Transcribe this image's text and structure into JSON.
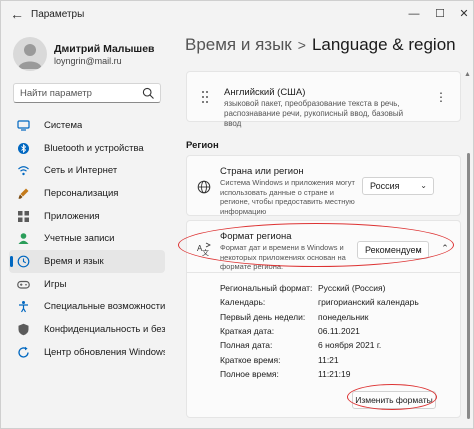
{
  "window": {
    "title": "Параметры"
  },
  "controls": {
    "minimize": "—",
    "maximize": "☐",
    "close": "✕"
  },
  "profile": {
    "name": "Дмитрий Малышев",
    "email": "loyngrin@mail.ru"
  },
  "search": {
    "placeholder": "Найти параметр"
  },
  "sidebar": {
    "items": [
      {
        "label": "Система",
        "icon": "monitor-icon",
        "color": "#0067c0"
      },
      {
        "label": "Bluetooth и устройства",
        "icon": "bluetooth-icon",
        "color": "#0067c0"
      },
      {
        "label": "Сеть и Интернет",
        "icon": "wifi-icon",
        "color": "#0067c0"
      },
      {
        "label": "Персонализация",
        "icon": "brush-icon",
        "color": "#c47a1a"
      },
      {
        "label": "Приложения",
        "icon": "apps-icon",
        "color": "#5b5b5b"
      },
      {
        "label": "Учетные записи",
        "icon": "person-icon",
        "color": "#2a9d59"
      },
      {
        "label": "Время и язык",
        "icon": "globe-clock-icon",
        "color": "#0067c0"
      },
      {
        "label": "Игры",
        "icon": "gamepad-icon",
        "color": "#5b5b5b"
      },
      {
        "label": "Специальные возможности",
        "icon": "accessibility-icon",
        "color": "#0067c0"
      },
      {
        "label": "Конфиденциальность и безопас",
        "icon": "shield-icon",
        "color": "#5b5b5b"
      },
      {
        "label": "Центр обновления Windows",
        "icon": "update-icon",
        "color": "#0067c0"
      }
    ],
    "active_index": 6
  },
  "breadcrumb": {
    "parent": "Время и язык",
    "separator": ">",
    "current": "Language & region"
  },
  "language_card": {
    "title": "Английский (США)",
    "subtitle": "языковой пакет, преобразование текста в речь, распознавание речи, рукописный ввод, базовый ввод"
  },
  "region": {
    "section_title": "Регион",
    "country": {
      "title": "Страна или регион",
      "subtitle": "Система Windows и приложения могут использовать данные о стране и регионе, чтобы предоставить местную информацию",
      "value": "Россия"
    },
    "format": {
      "title": "Формат региона",
      "subtitle": "Формат дат и времени в Windows и некоторых приложениях основан на формате региона.",
      "value": "Рекомендуем",
      "rows": [
        {
          "key": "Региональный формат:",
          "value": "Русский (Россия)"
        },
        {
          "key": "Календарь:",
          "value": "григорианский календарь"
        },
        {
          "key": "Первый день недели:",
          "value": "понедельник"
        },
        {
          "key": "Краткая дата:",
          "value": "06.11.2021"
        },
        {
          "key": "Полная дата:",
          "value": "6 ноября 2021 г."
        },
        {
          "key": "Краткое время:",
          "value": "11:21"
        },
        {
          "key": "Полное время:",
          "value": "11:21:19"
        }
      ],
      "change_button": "Изменить форматы"
    }
  },
  "colors": {
    "accent": "#0067c0",
    "annotation": "#dd3333"
  }
}
